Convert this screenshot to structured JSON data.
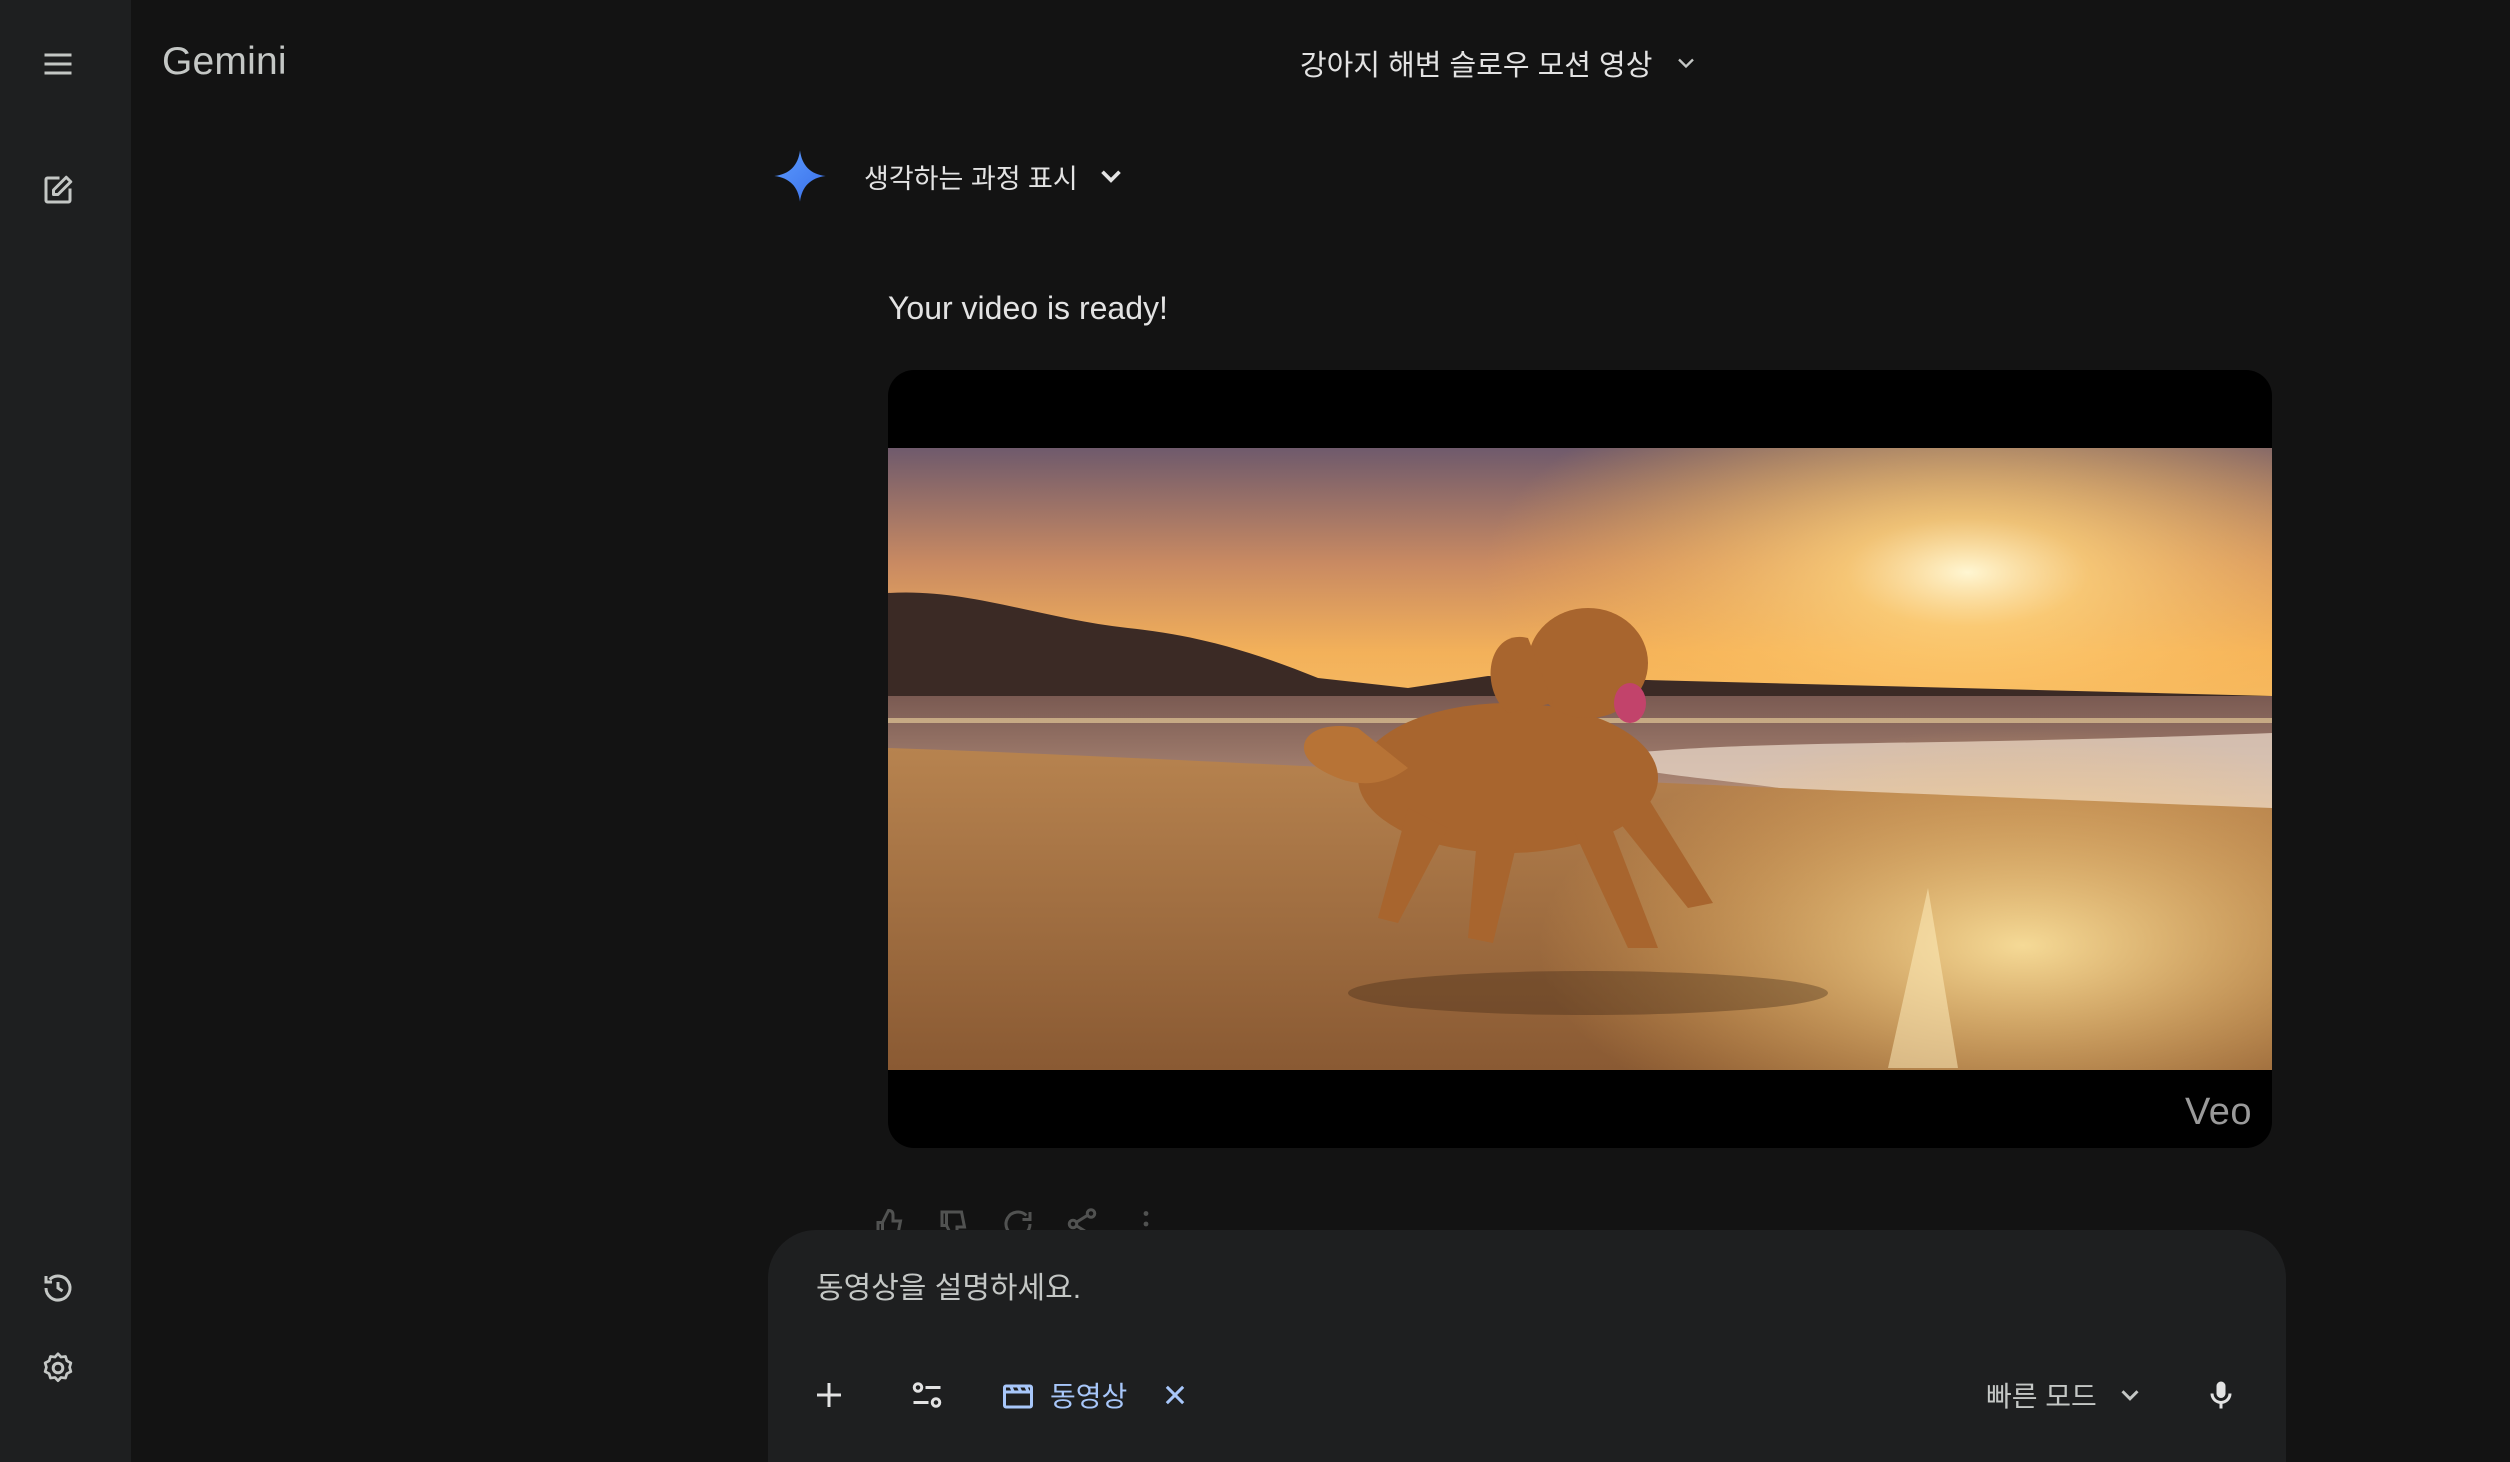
{
  "brand": "Gemini",
  "conversation_title": "강아지 해변 슬로우 모션 영상",
  "thinking": {
    "label": "생각하는 과정 표시"
  },
  "response": {
    "text": "Your video is ready!"
  },
  "video": {
    "watermark": "Veo"
  },
  "composer": {
    "placeholder": "동영상을 설명하세요.",
    "tool_chip_label": "동영상",
    "mode_label": "빠른 모드"
  },
  "colors": {
    "background": "#131313",
    "rail": "#1e1f20",
    "accent": "#a8c7fa",
    "spark": "#4f8df8"
  },
  "icons": {
    "menu": "menu-icon",
    "new_chat": "edit-icon",
    "history": "history-icon",
    "settings": "gear-icon",
    "spark": "gemini-spark-icon",
    "mic": "mic-icon"
  }
}
